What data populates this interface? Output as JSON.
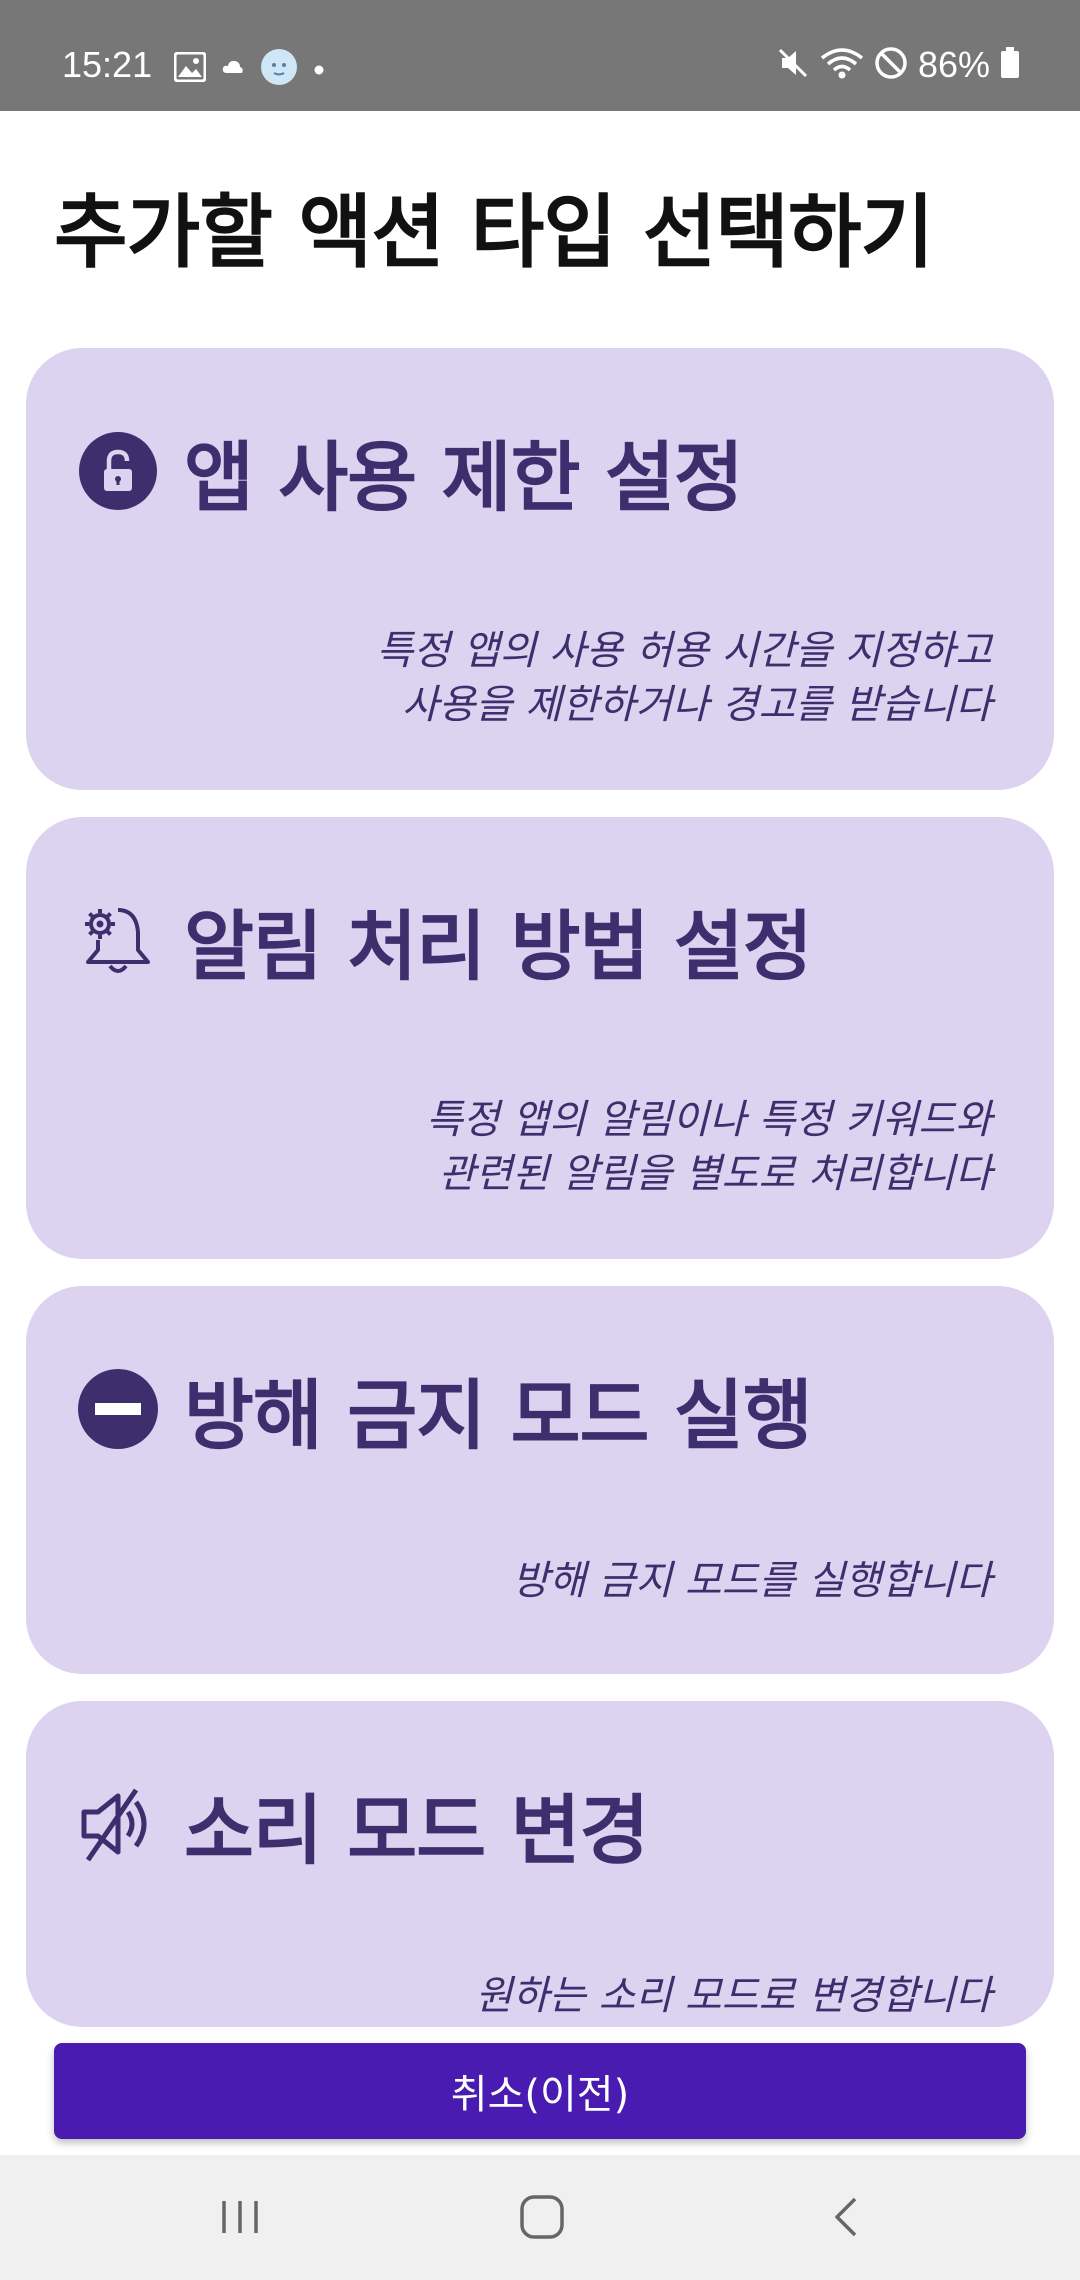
{
  "status_bar": {
    "time": "15:21",
    "left_icons": [
      "gallery-icon",
      "cloud-icon",
      "avatar-icon",
      "dot-icon"
    ],
    "right_icons": [
      "mute-icon",
      "wifi-icon",
      "do-not-disturb-icon"
    ],
    "battery": "86%"
  },
  "page": {
    "title": "추가할 액션 타입 선택하기"
  },
  "cards": [
    {
      "icon": "lock-icon",
      "title": "앱 사용 제한 설정",
      "description": "특정 앱의 사용 허용 시간을 지정하고\n사용을 제한하거나 경고를 받습니다"
    },
    {
      "icon": "notification-settings-icon",
      "title": "알림 처리 방법 설정",
      "description": "특정 앱의 알림이나 특정 키워드와\n관련된 알림을 별도로 처리합니다"
    },
    {
      "icon": "do-not-disturb-icon",
      "title": "방해 금지 모드 실행",
      "description": "방해 금지 모드를 실행합니다"
    },
    {
      "icon": "sound-off-icon",
      "title": "소리 모드 변경",
      "description": "원하는 소리 모드로 변경합니다"
    }
  ],
  "cancel_button": {
    "label": "취소(이전)"
  },
  "nav_bar": {
    "buttons": [
      "recent-apps-icon",
      "home-icon",
      "back-icon"
    ]
  },
  "colors": {
    "card_bg": "#dcd3f0",
    "card_text": "#3f2e6d",
    "button_bg": "#4a1bb0",
    "status_bar_bg": "#777777"
  }
}
